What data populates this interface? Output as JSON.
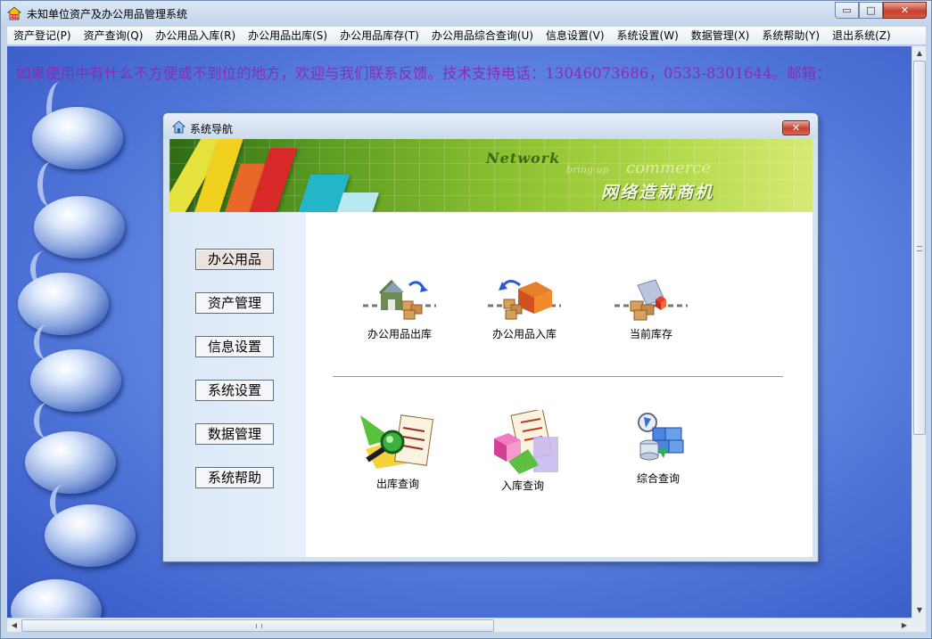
{
  "window": {
    "title": "未知单位资产及办公用品管理系统",
    "min_label": "▭",
    "max_label": "□",
    "close_label": "✕"
  },
  "menu": [
    "资产登记(P)",
    "资产查询(Q)",
    "办公用品入库(R)",
    "办公用品出库(S)",
    "办公用品库存(T)",
    "办公用品综合查询(U)",
    "信息设置(V)",
    "系统设置(W)",
    "数据管理(X)",
    "系统帮助(Y)",
    "退出系统(Z)"
  ],
  "notice": "如果使用中有什么不方便或不到位的地方，欢迎与我们联系反馈。技术支持电话：13046073686，0533-8301644。邮箱：",
  "nav_dialog": {
    "title": "系统导航",
    "close_label": "✕",
    "banner": {
      "network": "Network",
      "bring_up": "bring up",
      "commerce": "commerce",
      "slogan": "网络造就商机"
    },
    "sidebar": [
      "办公用品",
      "资产管理",
      "信息设置",
      "系统设置",
      "数据管理",
      "系统帮助"
    ],
    "functions": [
      {
        "label": "办公用品出库",
        "icon": "warehouse-out-icon"
      },
      {
        "label": "办公用品入库",
        "icon": "warehouse-in-icon"
      },
      {
        "label": "当前库存",
        "icon": "inventory-icon"
      },
      {
        "label": "出库查询",
        "icon": "outbound-query-icon"
      },
      {
        "label": "入库查询",
        "icon": "inbound-query-icon"
      },
      {
        "label": "综合查询",
        "icon": "combined-query-icon"
      }
    ]
  },
  "colors": {
    "notice_text": "#8a2cb8",
    "desktop_blue": "#5a7fe0",
    "banner_green": "#8fc333"
  }
}
